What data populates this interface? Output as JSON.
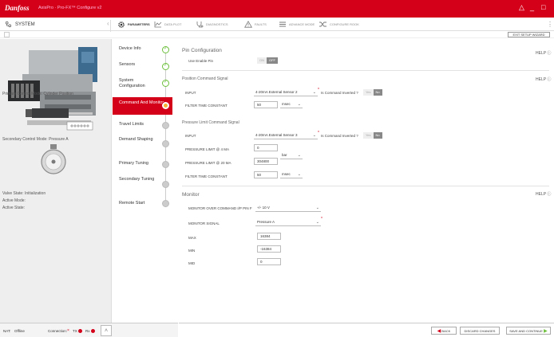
{
  "window": {
    "logo": "Danfoss",
    "title": "AxisPro · Pro-FX™ Configure v2"
  },
  "nav": {
    "system_label": "SYSTEM",
    "tabs": [
      {
        "label": "PARAMETERS"
      },
      {
        "label": "DATA PLOT"
      },
      {
        "label": "DIAGNOSTICS"
      },
      {
        "label": "FAULTS"
      },
      {
        "label": "ADVANCE MODE"
      },
      {
        "label": "CONFIGURE ROOK"
      }
    ],
    "exit_wizard": "EXIT SETUP WIZARD"
  },
  "left": {
    "primary_control": "Primary Control Mode: Cylinder Position",
    "secondary_control": "Secondary Control Mode: Pressure A",
    "valve_state": "Valve State: Initialization",
    "active_mode": "Active Mode:",
    "active_state": "Active State:",
    "status": {
      "node": "NAT:",
      "node_state": "Offline",
      "connection": "Connection:",
      "tx": "TX",
      "rx": "Rx"
    }
  },
  "steps": [
    {
      "label": "Device Info",
      "state": "done"
    },
    {
      "label": "Sensors",
      "state": "done"
    },
    {
      "label": "System Configuration",
      "state": "done"
    },
    {
      "label": "Command And Monitor",
      "state": "current"
    },
    {
      "label": "Travel Limits",
      "state": "todo"
    },
    {
      "label": "Demand Shaping",
      "state": "todo"
    },
    {
      "label": "Primary Tuning",
      "state": "todo"
    },
    {
      "label": "Secondary Tuning",
      "state": "todo"
    },
    {
      "label": "Remote Start",
      "state": "todo"
    }
  ],
  "main": {
    "help": "HELP",
    "pin_config": {
      "title": "Pin Configuration",
      "use_enable_pin": "Use Enable Pin",
      "toggle_on": "ON",
      "toggle_off": "OFF"
    },
    "position_command": {
      "title": "Position Command Signal",
      "input_label": "INPUT",
      "input_value": "4-20mA External Sensor 2",
      "inverted_label": "Is Command Inverted ?",
      "yes": "Yes",
      "no": "No",
      "filter_label": "FILTER TIME CONSTANT",
      "filter_value": "50",
      "filter_unit": "msec"
    },
    "pressure_command": {
      "title": "Pressure Limit Command Signal",
      "input_label": "INPUT",
      "input_value": "4-20mA External Sensor 3",
      "inverted_label": "Is Command Inverted ?",
      "yes": "Yes",
      "no": "No",
      "limit4_label": "PRESSURE LIMIT @ 4 MA",
      "limit4_value": "0",
      "limit20_label": "PRESSURE LIMIT @ 20 MA",
      "limit20_value": "304800",
      "pressure_unit": "bar",
      "filter_label": "FILTER TIME CONSTANT",
      "filter_value": "50",
      "filter_unit": "msec"
    },
    "monitor": {
      "title": "Monitor",
      "over_label": "MONITOR OVER COMMAND I/P PIN F",
      "over_value": "+/- 10 V",
      "signal_label": "MONITOR SIGNAL",
      "signal_value": "Pressure A",
      "max_label": "MAX",
      "max_value": "16384",
      "min_label": "MIN",
      "min_value": "-16384",
      "mid_label": "MID",
      "mid_value": "0"
    }
  },
  "bottom": {
    "back": "BACK",
    "discard": "DISCARD CHANGES",
    "save": "SAVE AND CONTINUE"
  },
  "colors": {
    "brand": "#d4001a",
    "done": "#6bbf3a",
    "current": "#f5b335"
  }
}
